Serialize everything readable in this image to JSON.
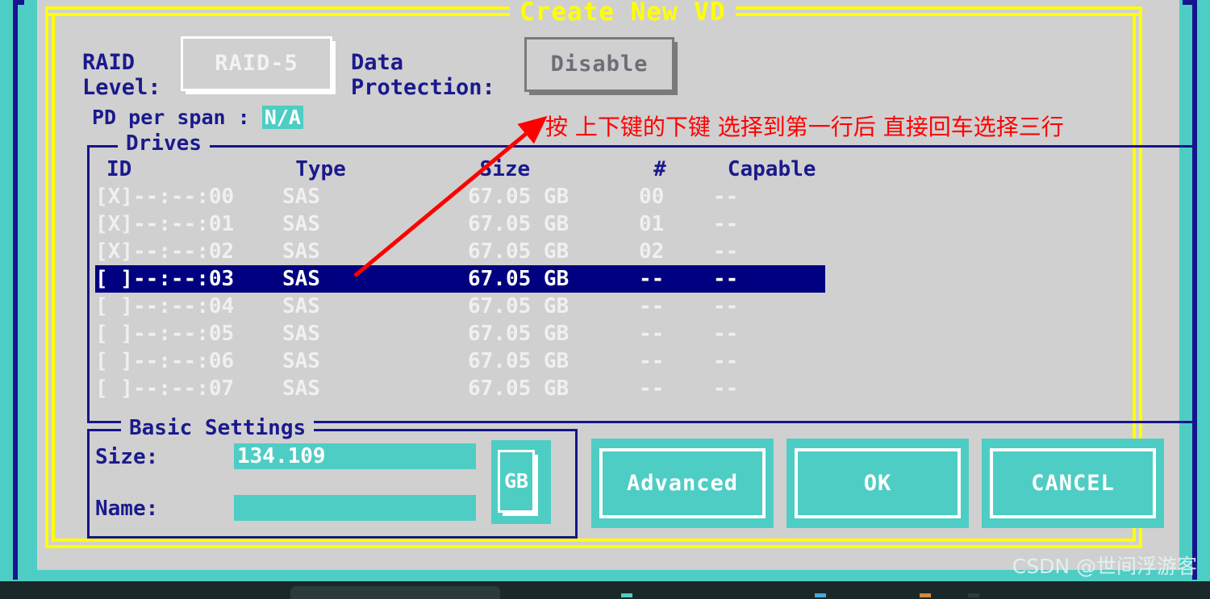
{
  "window": {
    "title": "Create New VD"
  },
  "colors": {
    "desktop_teal": "#4ecdc4",
    "dialog_gray": "#d0d0d0",
    "title_yellow": "#ffff00",
    "label_navy": "#1a1a8c",
    "selection_navy": "#000080",
    "annotation_red": "#ff0000",
    "disabled_gray": "#6e6e78"
  },
  "raid": {
    "level_label": "RAID\nLevel:",
    "level_value": "RAID-5",
    "protection_label": "Data\nProtection:",
    "protection_value": "Disable",
    "pd_per_span_label": "PD per span :",
    "pd_per_span_value": "N/A"
  },
  "drives": {
    "legend": "Drives",
    "columns": [
      "ID",
      "Type",
      "Size",
      "#",
      "Capable"
    ],
    "rows": [
      {
        "id": "[X]--:--:00",
        "type": "SAS",
        "size": "67.05 GB",
        "num": "00",
        "capable": "--",
        "selected": false,
        "checked": true
      },
      {
        "id": "[X]--:--:01",
        "type": "SAS",
        "size": "67.05 GB",
        "num": "01",
        "capable": "--",
        "selected": false,
        "checked": true
      },
      {
        "id": "[X]--:--:02",
        "type": "SAS",
        "size": "67.05 GB",
        "num": "02",
        "capable": "--",
        "selected": false,
        "checked": true
      },
      {
        "id": "[ ]--:--:03",
        "type": "SAS",
        "size": "67.05 GB",
        "num": "--",
        "capable": "--",
        "selected": true,
        "checked": false
      },
      {
        "id": "[ ]--:--:04",
        "type": "SAS",
        "size": "67.05 GB",
        "num": "--",
        "capable": "--",
        "selected": false,
        "checked": false
      },
      {
        "id": "[ ]--:--:05",
        "type": "SAS",
        "size": "67.05 GB",
        "num": "--",
        "capable": "--",
        "selected": false,
        "checked": false
      },
      {
        "id": "[ ]--:--:06",
        "type": "SAS",
        "size": "67.05 GB",
        "num": "--",
        "capable": "--",
        "selected": false,
        "checked": false
      },
      {
        "id": "[ ]--:--:07",
        "type": "SAS",
        "size": "67.05 GB",
        "num": "--",
        "capable": "--",
        "selected": false,
        "checked": false
      }
    ]
  },
  "basic_settings": {
    "legend": "Basic Settings",
    "size_label": "Size:",
    "size_value": "134.109",
    "name_label": "Name:",
    "name_value": "",
    "name_placeholder": "",
    "unit_value": "GB"
  },
  "buttons": {
    "advanced": "Advanced",
    "ok": "OK",
    "cancel": "CANCEL"
  },
  "annotation": {
    "text": "按 上下键的下键  选择到第一行后 直接回车选择三行"
  },
  "watermark": {
    "text": "CSDN @世间浮游客"
  }
}
